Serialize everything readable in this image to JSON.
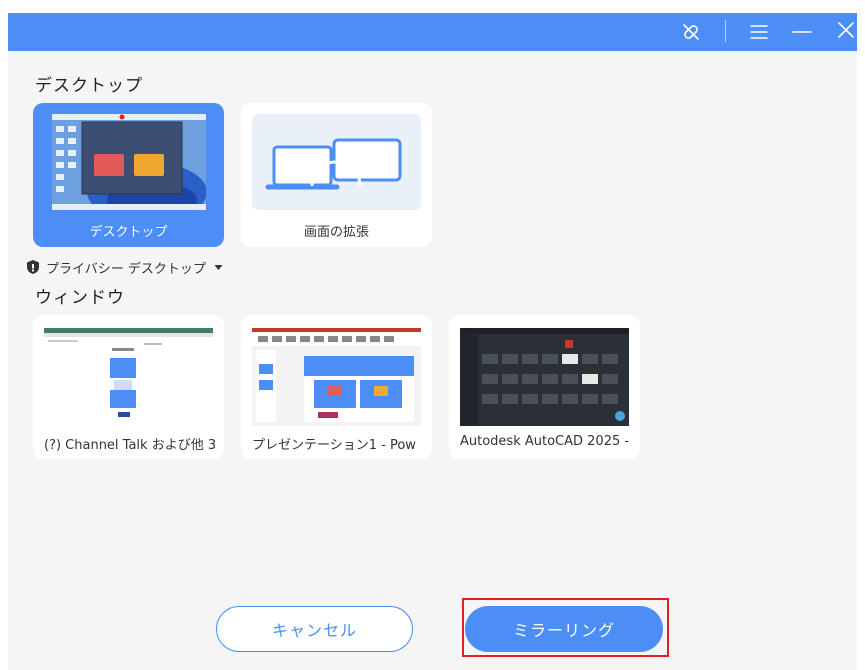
{
  "titlebar": {
    "icons": [
      "unlink-icon",
      "menu-icon",
      "minimize-icon",
      "close-icon"
    ]
  },
  "desktop_section": {
    "title": "デスクトップ",
    "tiles": [
      {
        "label": "デスクトップ",
        "selected": true
      },
      {
        "label": "画面の拡張",
        "selected": false
      }
    ]
  },
  "privacy": {
    "label": "プライバシー デスクトップ"
  },
  "window_section": {
    "title": "ウィンドウ",
    "windows": [
      {
        "label": "(?) Channel Talk および他 3"
      },
      {
        "label": "プレゼンテーション1 - Pow"
      },
      {
        "label": "Autodesk AutoCAD 2025 -"
      }
    ]
  },
  "footer": {
    "cancel_label": "キャンセル",
    "mirror_label": "ミラーリング"
  },
  "colors": {
    "accent": "#4d8df6",
    "highlight": "#e0201b"
  }
}
